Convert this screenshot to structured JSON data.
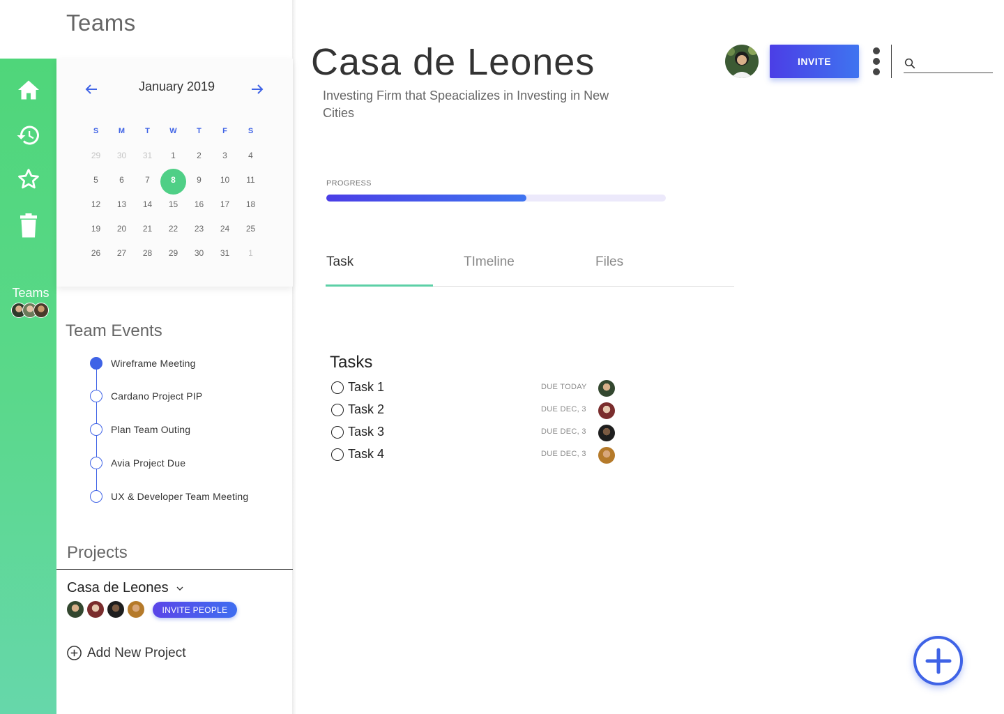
{
  "sidebar": {
    "title": "Teams",
    "rail": {
      "icons": [
        "home-icon",
        "history-icon",
        "star-icon",
        "trash-icon"
      ],
      "teams_label": "Teams",
      "accent": "#4fd67a"
    }
  },
  "calendar": {
    "month_label": "January 2019",
    "weekdays": [
      "S",
      "M",
      "T",
      "W",
      "T",
      "F",
      "S"
    ],
    "weeks": [
      [
        "29",
        "30",
        "31",
        "1",
        "2",
        "3",
        "4"
      ],
      [
        "5",
        "6",
        "7",
        "8",
        "9",
        "10",
        "11"
      ],
      [
        "12",
        "13",
        "14",
        "15",
        "16",
        "17",
        "18"
      ],
      [
        "19",
        "20",
        "21",
        "22",
        "23",
        "24",
        "25"
      ],
      [
        "26",
        "27",
        "28",
        "29",
        "30",
        "31",
        "1"
      ]
    ],
    "selected_day": "8"
  },
  "team_events": {
    "title": "Team Events",
    "items": [
      {
        "label": "Wireframe Meeting",
        "active": true
      },
      {
        "label": "Cardano Project PIP",
        "active": false
      },
      {
        "label": "Plan Team Outing",
        "active": false
      },
      {
        "label": "Avia Project Due",
        "active": false
      },
      {
        "label": "UX & Developer Team Meeting",
        "active": false
      }
    ]
  },
  "projects": {
    "title": "Projects",
    "current": "Casa de Leones",
    "invite_label": "INVITE PEOPLE",
    "add_label": "Add New Project"
  },
  "header": {
    "title": "Casa de Leones",
    "subtitle": "Investing Firm that Speacializes in Investing in New Cities",
    "invite_label": "INVITE",
    "search_value": ""
  },
  "progress": {
    "label": "PROGRESS",
    "value_percent": 59,
    "color": "#3f63e6"
  },
  "tabs": [
    {
      "label": "Task",
      "active": true
    },
    {
      "label": "TImeline",
      "active": false
    },
    {
      "label": "Files",
      "active": false
    }
  ],
  "tasks": {
    "title": "Tasks",
    "items": [
      {
        "label": "Task 1",
        "due": "DUE TODAY"
      },
      {
        "label": "Task 2",
        "due": "DUE DEC, 3"
      },
      {
        "label": "Task 3",
        "due": "DUE DEC, 3"
      },
      {
        "label": "Task 4",
        "due": "DUE DEC, 3"
      }
    ]
  }
}
